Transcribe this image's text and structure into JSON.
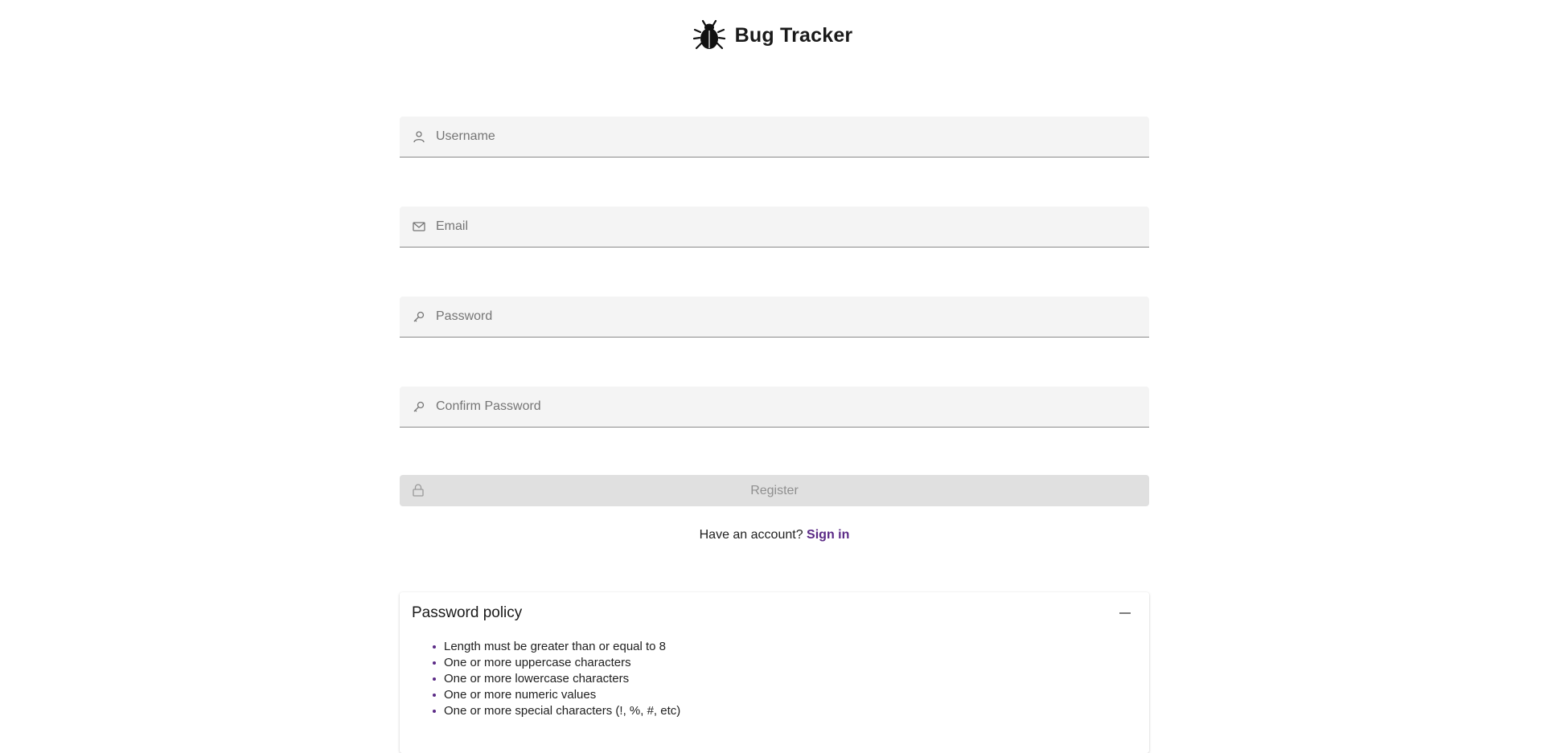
{
  "app": {
    "title": "Bug Tracker",
    "logo_icon": "bug-icon"
  },
  "form": {
    "username": {
      "placeholder": "Username",
      "value": "",
      "icon": "user-icon"
    },
    "email": {
      "placeholder": "Email",
      "value": "",
      "icon": "envelope-icon"
    },
    "password": {
      "placeholder": "Password",
      "value": "",
      "icon": "key-icon"
    },
    "confirm_password": {
      "placeholder": "Confirm Password",
      "value": "",
      "icon": "key-icon"
    },
    "register_label": "Register",
    "register_icon": "lock-icon",
    "register_disabled": true
  },
  "account": {
    "prompt": "Have an account?",
    "sign_in_label": "Sign in"
  },
  "policy": {
    "title": "Password policy",
    "collapse_icon": "minus-icon",
    "expanded": true,
    "rules": [
      "Length must be greater than or equal to 8",
      "One or more uppercase characters",
      "One or more lowercase characters",
      "One or more numeric values",
      "One or more special characters (!, %, #, etc)"
    ]
  },
  "colors": {
    "accent": "#5b2a86",
    "field_bg": "#f4f4f4",
    "button_disabled_bg": "#e0e0e0"
  }
}
